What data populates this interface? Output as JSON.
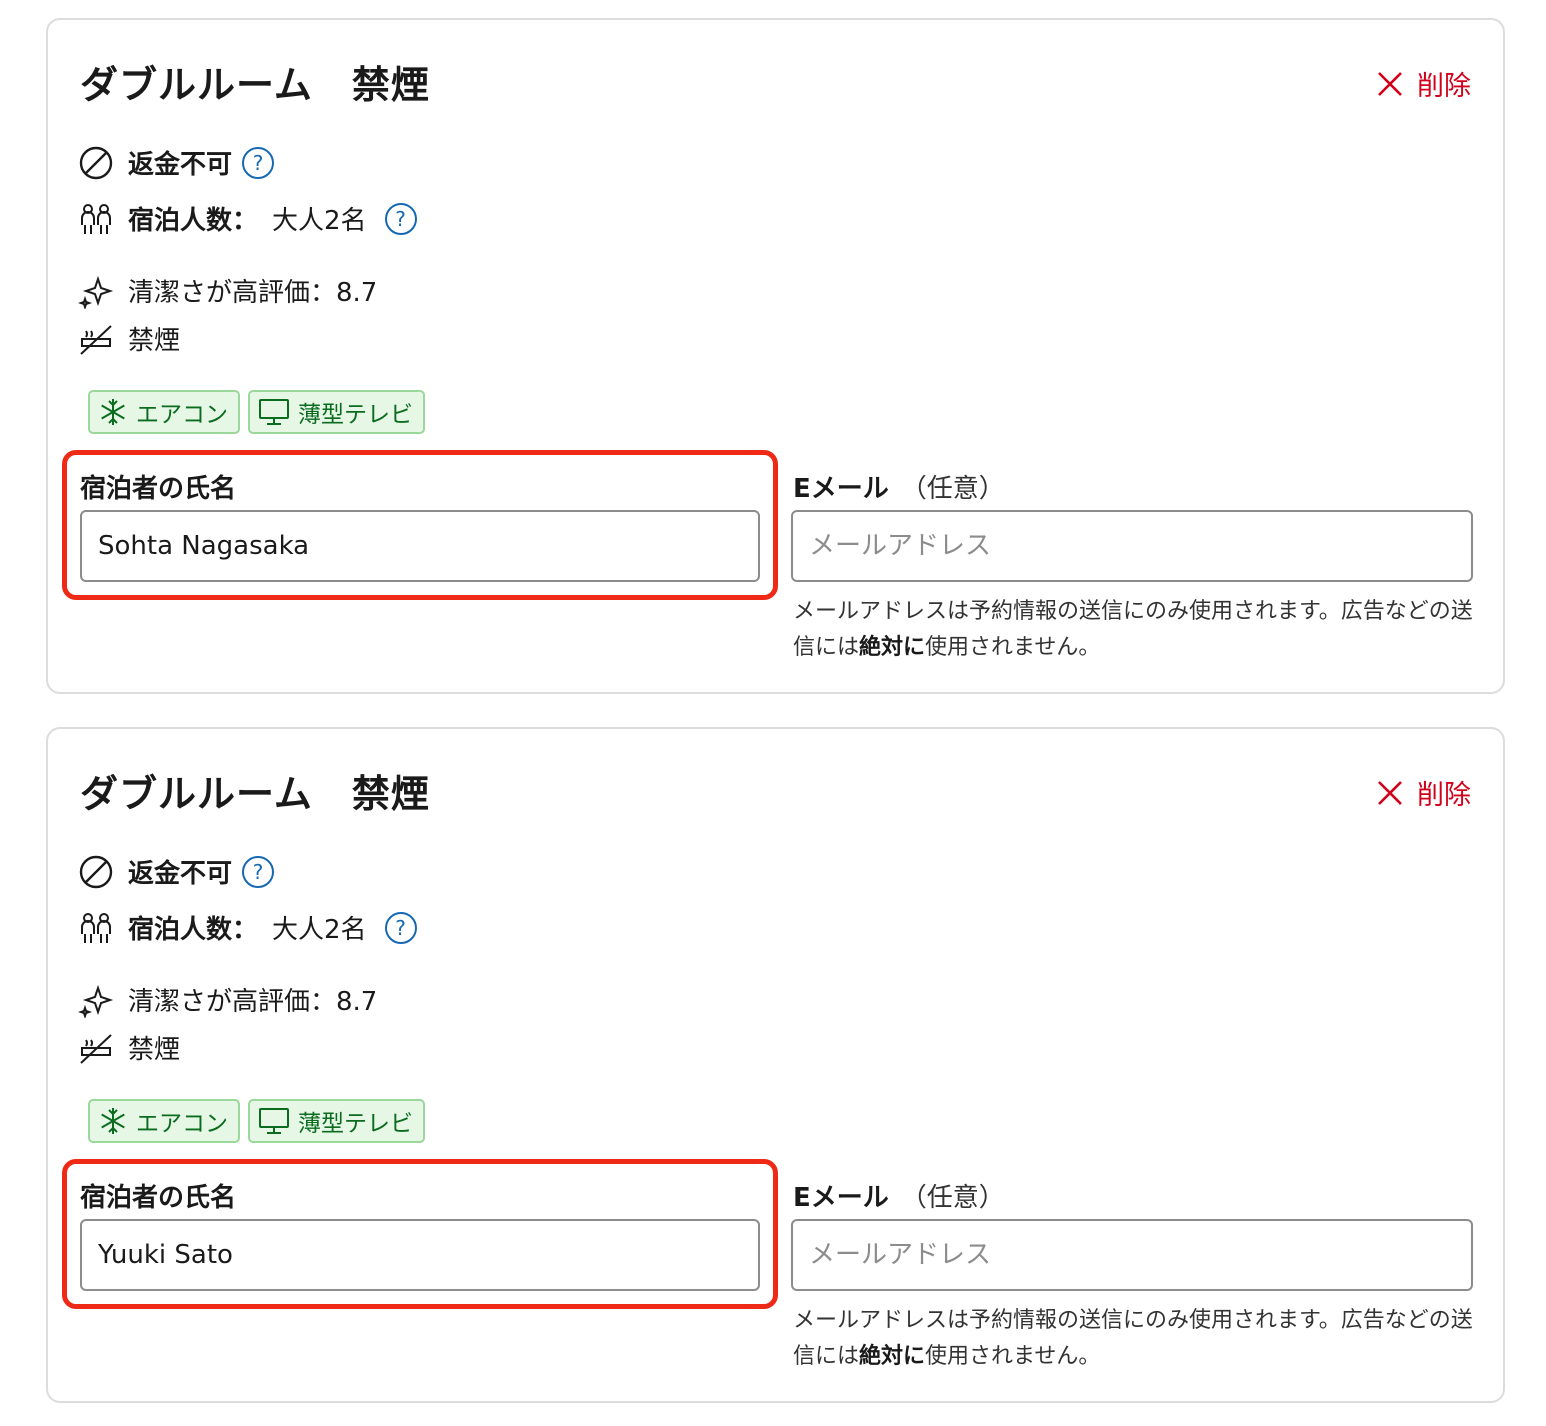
{
  "accent_colors": {
    "delete": "#d0021b",
    "help": "#1668b3",
    "chip_bg": "#e6f7e6",
    "chip_text": "#0b6b1f",
    "highlight": "#ee2a17"
  },
  "rooms": [
    {
      "title": "ダブルルーム　禁煙",
      "delete_label": "削除",
      "refund": "返金不可",
      "guests_label": "宿泊人数：",
      "guests_value": "大人2名",
      "cleanliness": "清潔さが高評価：8.7",
      "smoking": "禁煙",
      "amenities": [
        {
          "label": "エアコン",
          "icon": "snowflake-icon"
        },
        {
          "label": "薄型テレビ",
          "icon": "tv-icon"
        }
      ],
      "name_label": "宿泊者の氏名",
      "name_value": "Sohta Nagasaka",
      "email_label": "Eメール",
      "email_optional": "（任意）",
      "email_placeholder": "メールアドレス",
      "email_note_before": "メールアドレスは予約情報の送信にのみ使用されます。広告などの送信には",
      "email_note_bold": "絶対に",
      "email_note_after": "使用されません。"
    },
    {
      "title": "ダブルルーム　禁煙",
      "delete_label": "削除",
      "refund": "返金不可",
      "guests_label": "宿泊人数：",
      "guests_value": "大人2名",
      "cleanliness": "清潔さが高評価：8.7",
      "smoking": "禁煙",
      "amenities": [
        {
          "label": "エアコン",
          "icon": "snowflake-icon"
        },
        {
          "label": "薄型テレビ",
          "icon": "tv-icon"
        }
      ],
      "name_label": "宿泊者の氏名",
      "name_value": "Yuuki Sato",
      "email_label": "Eメール",
      "email_optional": "（任意）",
      "email_placeholder": "メールアドレス",
      "email_note_before": "メールアドレスは予約情報の送信にのみ使用されます。広告などの送信には",
      "email_note_bold": "絶対に",
      "email_note_after": "使用されません。"
    }
  ]
}
